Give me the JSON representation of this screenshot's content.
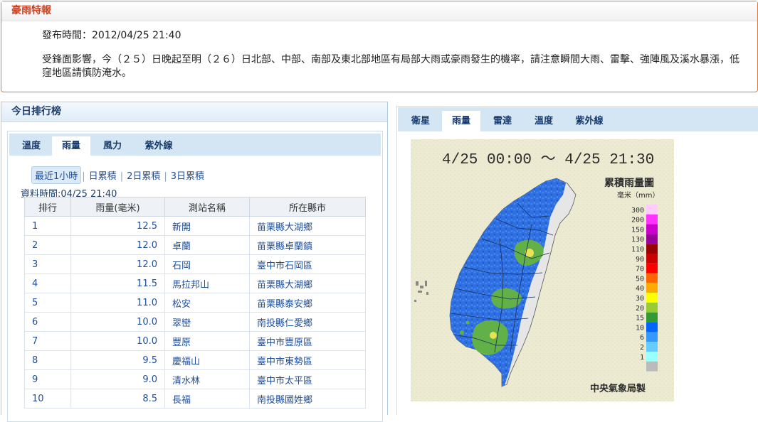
{
  "warning": {
    "title": "豪雨特報",
    "issued": "發布時間：2012/04/25 21:40",
    "body": "受鋒面影響，今（２５）日晚起至明（２６）日北部、中部、南部及東北部地區有局部大雨或豪雨發生的機率，請注意瞬間大雨、雷擊、強陣風及溪水暴漲，低窪地區請慎防淹水。"
  },
  "ranking": {
    "title": "今日排行榜",
    "tabs": [
      "溫度",
      "雨量",
      "風力",
      "紫外線"
    ],
    "active_tab": "雨量",
    "subtabs": [
      "最近1小時",
      "日累積",
      "2日累積",
      "3日累積"
    ],
    "active_subtab": "最近1小時",
    "data_time": "資料時間:04/25 21:40",
    "columns": [
      "排行",
      "雨量(毫米)",
      "測站名稱",
      "所在縣市"
    ],
    "rows": [
      {
        "rank": "1",
        "value": "12.5",
        "station": "新開",
        "location": "苗栗縣大湖鄉"
      },
      {
        "rank": "2",
        "value": "12.0",
        "station": "卓蘭",
        "location": "苗栗縣卓蘭鎮"
      },
      {
        "rank": "3",
        "value": "12.0",
        "station": "石岡",
        "location": "臺中市石岡區"
      },
      {
        "rank": "4",
        "value": "11.5",
        "station": "馬拉邦山",
        "location": "苗栗縣大湖鄉"
      },
      {
        "rank": "5",
        "value": "11.0",
        "station": "松安",
        "location": "苗栗縣泰安鄉"
      },
      {
        "rank": "6",
        "value": "10.0",
        "station": "翠巒",
        "location": "南投縣仁愛鄉"
      },
      {
        "rank": "7",
        "value": "10.0",
        "station": "豐原",
        "location": "臺中市豐原區"
      },
      {
        "rank": "8",
        "value": "9.5",
        "station": "慶福山",
        "location": "臺中市東勢區"
      },
      {
        "rank": "9",
        "value": "9.0",
        "station": "清水林",
        "location": "臺中市太平區"
      },
      {
        "rank": "10",
        "value": "8.5",
        "station": "長福",
        "location": "南投縣國姓鄉"
      }
    ]
  },
  "map_panel": {
    "tabs": [
      "衛星",
      "雨量",
      "雷達",
      "溫度",
      "紫外線"
    ],
    "active_tab": "雨量",
    "map": {
      "time_range": "4/25 00:00 ～ 4/25 21:30",
      "legend_title": "累積雨量圖",
      "legend_unit": "毫米（mm）",
      "legend": [
        {
          "label": "300",
          "color": "#ffccff"
        },
        {
          "label": "200",
          "color": "#ff33ff"
        },
        {
          "label": "150",
          "color": "#cc00cc"
        },
        {
          "label": "130",
          "color": "#990099"
        },
        {
          "label": "110",
          "color": "#990000"
        },
        {
          "label": "90",
          "color": "#cc0000"
        },
        {
          "label": "70",
          "color": "#ff0000"
        },
        {
          "label": "50",
          "color": "#ff6600"
        },
        {
          "label": "40",
          "color": "#ffaa00"
        },
        {
          "label": "30",
          "color": "#ffff00"
        },
        {
          "label": "20",
          "color": "#99cc33"
        },
        {
          "label": "15",
          "color": "#339933"
        },
        {
          "label": "10",
          "color": "#0066ff"
        },
        {
          "label": "6",
          "color": "#3399ff"
        },
        {
          "label": "2",
          "color": "#66ccff"
        },
        {
          "label": "1",
          "color": "#99ffff"
        },
        {
          "label": "",
          "color": "#bbbbbb"
        }
      ],
      "producer": "中央氣象局製",
      "colors": {
        "background": "#ecebd2",
        "land": "#2f6fe0",
        "heavy": "#69b34a",
        "dry": "#e8e8e8"
      }
    }
  }
}
